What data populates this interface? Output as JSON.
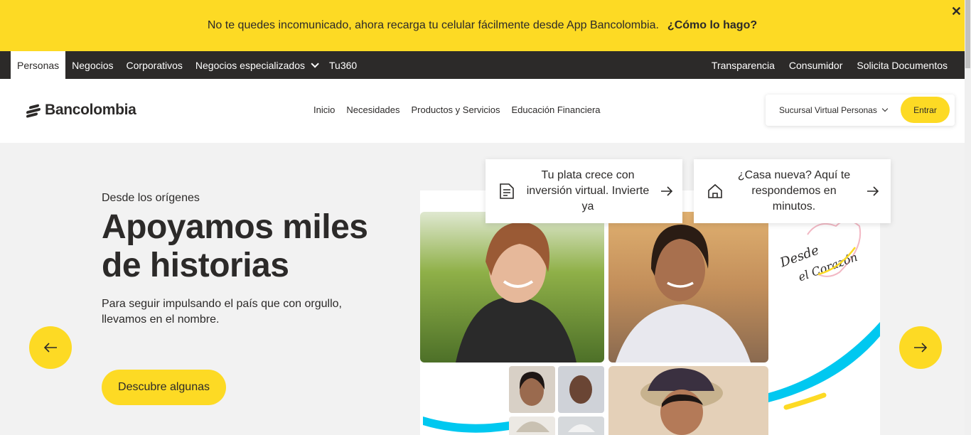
{
  "banner": {
    "message": "No te quedes incomunicado, ahora recarga tu celular fácilmente desde App Bancolombia.",
    "link": "¿Cómo lo hago?",
    "close": "✕"
  },
  "topnav": {
    "left": [
      "Personas",
      "Negocios",
      "Corporativos",
      "Negocios especializados",
      "Tu360"
    ],
    "right": [
      "Transparencia",
      "Consumidor",
      "Solicita Documentos"
    ]
  },
  "header": {
    "logo": "Bancolombia",
    "nav": [
      "Inicio",
      "Necesidades",
      "Productos y Servicios",
      "Educación Financiera"
    ],
    "sucursal": "Sucursal Virtual Personas",
    "entrar": "Entrar"
  },
  "hero": {
    "eyebrow": "Desde los orígenes",
    "headline_1": "Apoyamos miles",
    "headline_2": "de historias",
    "subtext": "Para seguir impulsando el país que con orgullo, llevamos en el nombre.",
    "cta": "Descubre algunas"
  },
  "cards": [
    {
      "text": "Tu plata crece con inversión virtual. Invierte ya",
      "icon": "document-icon"
    },
    {
      "text": "¿Casa nueva? Aquí te respondemos en minutos.",
      "icon": "house-icon"
    }
  ],
  "colors": {
    "brand_yellow": "#fdda24",
    "dark": "#2c2a29",
    "accent_cyan": "#00c8f0"
  }
}
